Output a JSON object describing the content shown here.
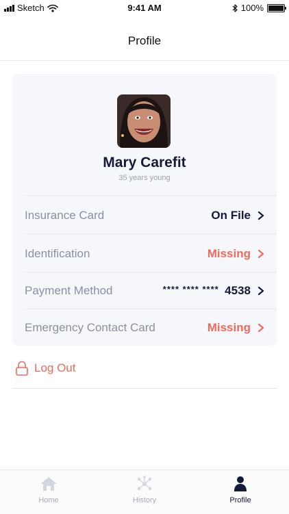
{
  "status_bar": {
    "carrier": "Sketch",
    "time": "9:41 AM",
    "battery_percent": "100%",
    "battery_level": 1.0
  },
  "nav": {
    "title": "Profile"
  },
  "profile": {
    "name": "Mary Carefit",
    "subtitle": "35 years young"
  },
  "items": [
    {
      "label": "Insurance Card",
      "value": "On File",
      "status": "ok"
    },
    {
      "label": "Identification",
      "value": "Missing",
      "status": "missing"
    },
    {
      "label": "Payment Method",
      "card_mask": "**** **** ****",
      "value": "4538",
      "status": "ok"
    },
    {
      "label": "Emergency Contact Card",
      "value": "Missing",
      "status": "missing"
    }
  ],
  "logout": {
    "label": "Log Out"
  },
  "tabs": [
    {
      "label": "Home",
      "icon": "home-icon",
      "active": false
    },
    {
      "label": "History",
      "icon": "history-network-icon",
      "active": false
    },
    {
      "label": "Profile",
      "icon": "person-icon",
      "active": true
    }
  ],
  "colors": {
    "accent": "#ee6a5d",
    "navy": "#161a3a",
    "muted": "#8b90a2",
    "card_bg": "#f6f7fa"
  }
}
